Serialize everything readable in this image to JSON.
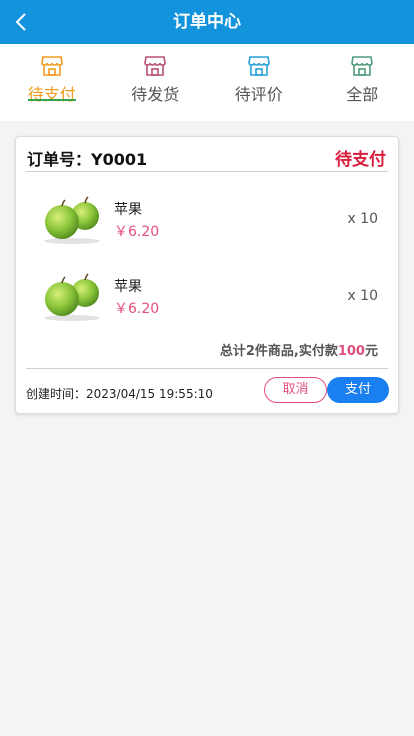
{
  "navbar": {
    "title": "订单中心",
    "back_icon": "chevron-left-icon"
  },
  "tabs": [
    {
      "label": "待支付",
      "icon": "shop-icon",
      "color": "#f19d1e",
      "active": true
    },
    {
      "label": "待发货",
      "icon": "shop-icon",
      "color": "#b85078",
      "active": false
    },
    {
      "label": "待评价",
      "icon": "shop-icon",
      "color": "#2a9fd8",
      "active": false
    },
    {
      "label": "全部",
      "icon": "shop-icon",
      "color": "#4f9a7a",
      "active": false
    }
  ],
  "order": {
    "number_label": "订单号：",
    "number": "Y0001",
    "status": "待支付",
    "items": [
      {
        "name": "苹果",
        "price": "￥6.20",
        "qty": "x 10",
        "image": "green-apples-image"
      },
      {
        "name": "苹果",
        "price": "￥6.20",
        "qty": "x 10",
        "image": "green-apples-image"
      }
    ],
    "summary_prefix": "总计2件商品,实付款",
    "summary_amount": "100",
    "summary_suffix": "元",
    "created_label": "创建时间：",
    "created_time": "2023/04/15 19:55:10",
    "cancel_label": "取消",
    "pay_label": "支付"
  },
  "colors": {
    "header": "#1493dd",
    "status": "#d81e3c",
    "price": "#e0507a",
    "pay_button": "#1a7ff0",
    "active_tab": "#f19d1e",
    "tab_underline": "#3aa14a"
  }
}
